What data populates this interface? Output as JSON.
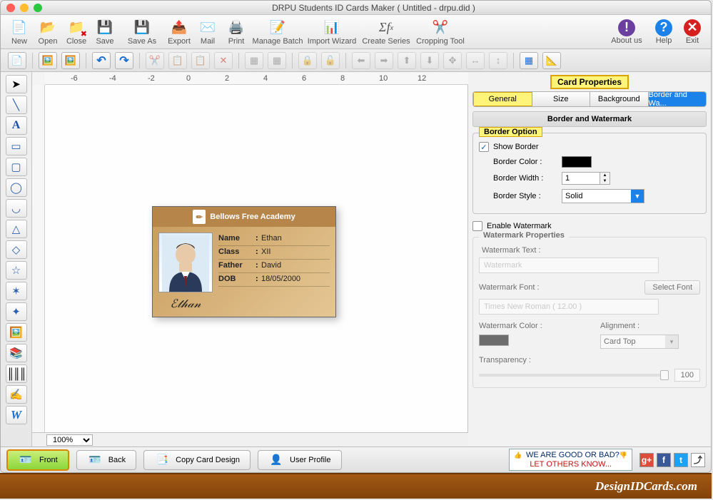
{
  "window": {
    "title": "DRPU Students ID Cards Maker ( Untitled - drpu.did )"
  },
  "toolbar": {
    "new": "New",
    "open": "Open",
    "close": "Close",
    "save": "Save",
    "saveas": "Save As",
    "export": "Export",
    "mail": "Mail",
    "print": "Print",
    "batch": "Manage Batch",
    "import": "Import Wizard",
    "series": "Create Series",
    "crop": "Cropping Tool",
    "about": "About us",
    "help": "Help",
    "exit": "Exit"
  },
  "ruler": [
    "-6",
    "-4",
    "-2",
    "0",
    "2",
    "4",
    "6",
    "8",
    "10",
    "12"
  ],
  "card": {
    "school": "Bellows Free Academy",
    "rows": [
      {
        "k": "Name",
        "v": "Ethan"
      },
      {
        "k": "Class",
        "v": "XII"
      },
      {
        "k": "Father",
        "v": "David"
      },
      {
        "k": "DOB",
        "v": "18/05/2000"
      }
    ]
  },
  "zoom": "100%",
  "props": {
    "title": "Card Properties",
    "tabs": [
      "General",
      "Size",
      "Background",
      "Border and Wa..."
    ],
    "section_title": "Border and Watermark",
    "border_group": "Border Option",
    "show_border": "Show Border",
    "border_color": "Border Color :",
    "border_width_lbl": "Border Width :",
    "border_width_val": "1",
    "border_style_lbl": "Border Style :",
    "border_style_val": "Solid",
    "enable_wm": "Enable Watermark",
    "wm_group": "Watermark Properties",
    "wm_text_lbl": "Watermark Text :",
    "wm_text_ph": "Watermark",
    "wm_font_lbl": "Watermark Font :",
    "wm_font_btn": "Select Font",
    "wm_font_val": "Times New Roman ( 12.00 )",
    "wm_color_lbl": "Watermark Color :",
    "wm_align_lbl": "Alignment :",
    "wm_align_val": "Card Top",
    "wm_trans_lbl": "Transparency :",
    "wm_trans_val": "100"
  },
  "bottom": {
    "front": "Front",
    "back": "Back",
    "copy": "Copy Card Design",
    "user": "User Profile",
    "rate1": "WE ARE GOOD OR BAD?",
    "rate2": "LET OTHERS KNOW..."
  },
  "footer": "DesignIDCards.com"
}
